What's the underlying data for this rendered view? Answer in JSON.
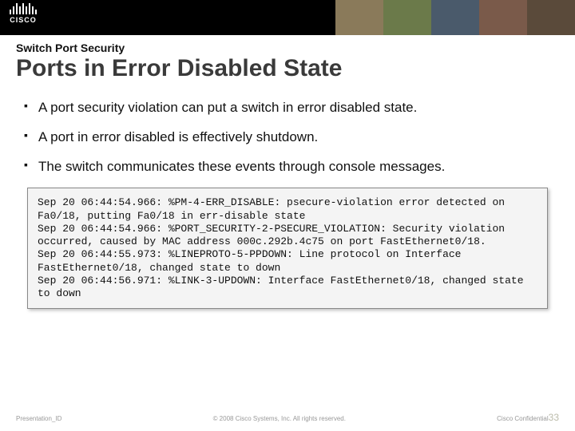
{
  "brand": {
    "name": "CISCO"
  },
  "header": {
    "eyebrow": "Switch Port Security",
    "title": "Ports in Error Disabled State"
  },
  "bullets": [
    "A port security violation can put a switch in error disabled state.",
    "A port in error disabled is effectively shutdown.",
    "The switch communicates these events through console messages."
  ],
  "console": "Sep 20 06:44:54.966: %PM-4-ERR_DISABLE: psecure-violation error detected on Fa0/18, putting Fa0/18 in err-disable state\nSep 20 06:44:54.966: %PORT_SECURITY-2-PSECURE_VIOLATION: Security violation occurred, caused by MAC address 000c.292b.4c75 on port FastEthernet0/18.\nSep 20 06:44:55.973: %LINEPROTO-5-PPDOWN: Line protocol on Interface FastEthernet0/18, changed state to down\nSep 20 06:44:56.971: %LINK-3-UPDOWN: Interface FastEthernet0/18, changed state to down",
  "footer": {
    "left": "Presentation_ID",
    "center": "© 2008 Cisco Systems, Inc. All rights reserved.",
    "right": "Cisco Confidential",
    "page": "33"
  }
}
